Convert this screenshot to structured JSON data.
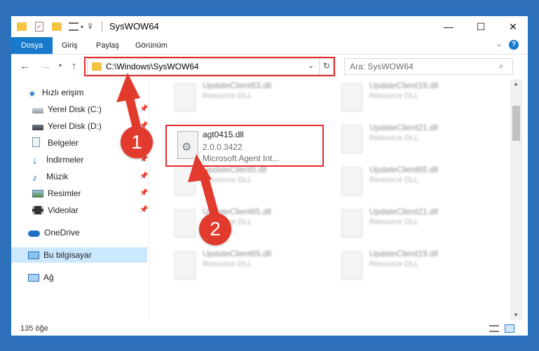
{
  "window": {
    "title": "SysWOW64",
    "controls": {
      "minimize": "—",
      "maximize": "☐",
      "close": "✕"
    }
  },
  "ribbon": {
    "tabs": [
      "Dosya",
      "Giriş",
      "Paylaş",
      "Görünüm"
    ]
  },
  "address": {
    "path": "C:\\Windows\\SysWOW64",
    "search_placeholder": "Ara: SysWOW64"
  },
  "nav": {
    "quick_access": "Hızlı erişim",
    "items": [
      {
        "label": "Yerel Disk (C:)",
        "icon": "drive-icon"
      },
      {
        "label": "Yerel Disk (D:)",
        "icon": "drive-icon"
      },
      {
        "label": "Belgeler",
        "icon": "documents-icon"
      },
      {
        "label": "İndirmeler",
        "icon": "download-icon"
      },
      {
        "label": "Müzik",
        "icon": "music-icon"
      },
      {
        "label": "Resimler",
        "icon": "pictures-icon"
      },
      {
        "label": "Videolar",
        "icon": "video-icon"
      }
    ],
    "onedrive": "OneDrive",
    "this_pc": "Bu bilgisayar",
    "network": "Ağ"
  },
  "files": {
    "left": [
      {
        "name": "UpdateClient63.dll",
        "type": "Resource DLL"
      },
      {
        "name": "UpdateClient5.dll",
        "type": "Resource DLL"
      },
      {
        "name": "UpdateClient65.dll",
        "type": "Resource DLL"
      },
      {
        "name": "UpdateClient65.dll",
        "type": "Resource DLL"
      }
    ],
    "right": [
      {
        "name": "UpdateClient19.dll",
        "type": "Resource DLL"
      },
      {
        "name": "UpdateClient21.dll",
        "type": "Resource DLL"
      },
      {
        "name": "UpdateClient65.dll",
        "type": "Resource DLL"
      },
      {
        "name": "UpdateClient21.dll",
        "type": "Resource DLL"
      },
      {
        "name": "UpdateClient19.dll",
        "type": "Resource DLL"
      }
    ],
    "selected": {
      "name": "agt0415.dll",
      "version": "2.0.0.3422",
      "description": "Microsoft Agent Int..."
    }
  },
  "status": {
    "count": "135 öğe"
  },
  "annotations": {
    "step1": "1",
    "step2": "2",
    "color": "#e33a2e"
  }
}
